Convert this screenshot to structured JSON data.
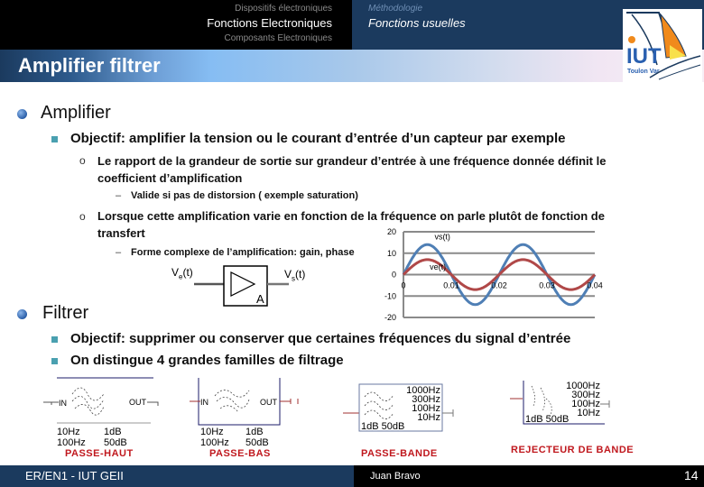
{
  "header": {
    "nav_left": [
      "Dispositifs électroniques",
      "Fonctions  Electroniques",
      "Composants Electroniques"
    ],
    "nav_right": [
      "Méthodologie",
      "Fonctions usuelles"
    ],
    "title": "Amplifier filtrer",
    "logo": {
      "label": "IUT",
      "sublabel": "Toulon Var"
    }
  },
  "content": {
    "amplifier": {
      "heading": "Amplifier",
      "objective": "Objectif: amplifier la tension ou le courant d’entrée d’un capteur par exemple",
      "point1_line1": "Le rapport de la grandeur de sortie sur grandeur d’entrée à une fréquence donnée définit le",
      "point1_line2": "coefficient d’amplification",
      "point1_sub": "Valide si pas de distorsion ( exemple saturation)",
      "point2_line1": "Lorsque cette amplification varie en fonction de la fréquence on parle plutôt de fonction de",
      "point2_line2": "transfert",
      "point2_sub": "Forme complexe de l’amplification: gain, phase",
      "diagram": {
        "input": "V",
        "input_sub": "e",
        "input_t": "(t)",
        "output": "V",
        "output_sub": "s",
        "output_t": "(t)",
        "block_label": "A"
      }
    },
    "filter": {
      "heading": "Filtrer",
      "objective": "Objectif: supprimer ou conserver que certaines fréquences du signal d’entrée",
      "families": "On distingue 4 grandes familles de filtrage",
      "types": [
        {
          "name": "PASSE-HAUT",
          "in": "IN",
          "out": "OUT",
          "row1": [
            "10Hz",
            "1dB"
          ],
          "row2": [
            "100Hz",
            "50dB"
          ]
        },
        {
          "name": "PASSE-BAS",
          "in": "IN",
          "out": "OUT",
          "row1": [
            "10Hz",
            "1dB"
          ],
          "row2": [
            "100Hz",
            "50dB"
          ]
        },
        {
          "name": "PASSE-BANDE",
          "freqs": [
            "1000Hz",
            "300Hz",
            "100Hz",
            "10Hz"
          ],
          "db": "1dB  50dB"
        },
        {
          "name": "REJECTEUR DE BANDE",
          "freqs": [
            "1000Hz",
            "300Hz",
            "100Hz",
            "10Hz"
          ],
          "db": "1dB  50dB"
        }
      ]
    }
  },
  "chart_data": {
    "type": "line",
    "title": "",
    "xlabel": "",
    "ylabel": "",
    "xlim": [
      0,
      0.04
    ],
    "ylim": [
      -20,
      20
    ],
    "x_ticks": [
      "0",
      "0.01",
      "0.02",
      "0.03",
      "0.04"
    ],
    "y_ticks": [
      "20",
      "10",
      "0",
      "-10",
      "-20"
    ],
    "grid": true,
    "series": [
      {
        "name": "vs(t)",
        "function": "14*sin(2*pi*50*t)",
        "amplitude": 14,
        "frequency_hz": 50,
        "color": "#4f7fb5"
      },
      {
        "name": "ve(t)",
        "function": "7*sin(2*pi*50*t)",
        "amplitude": 7,
        "frequency_hz": 50,
        "color": "#b04848"
      }
    ]
  },
  "footer": {
    "left": "ER/EN1 - IUT GEII",
    "center": "Juan Bravo",
    "page": "14"
  }
}
